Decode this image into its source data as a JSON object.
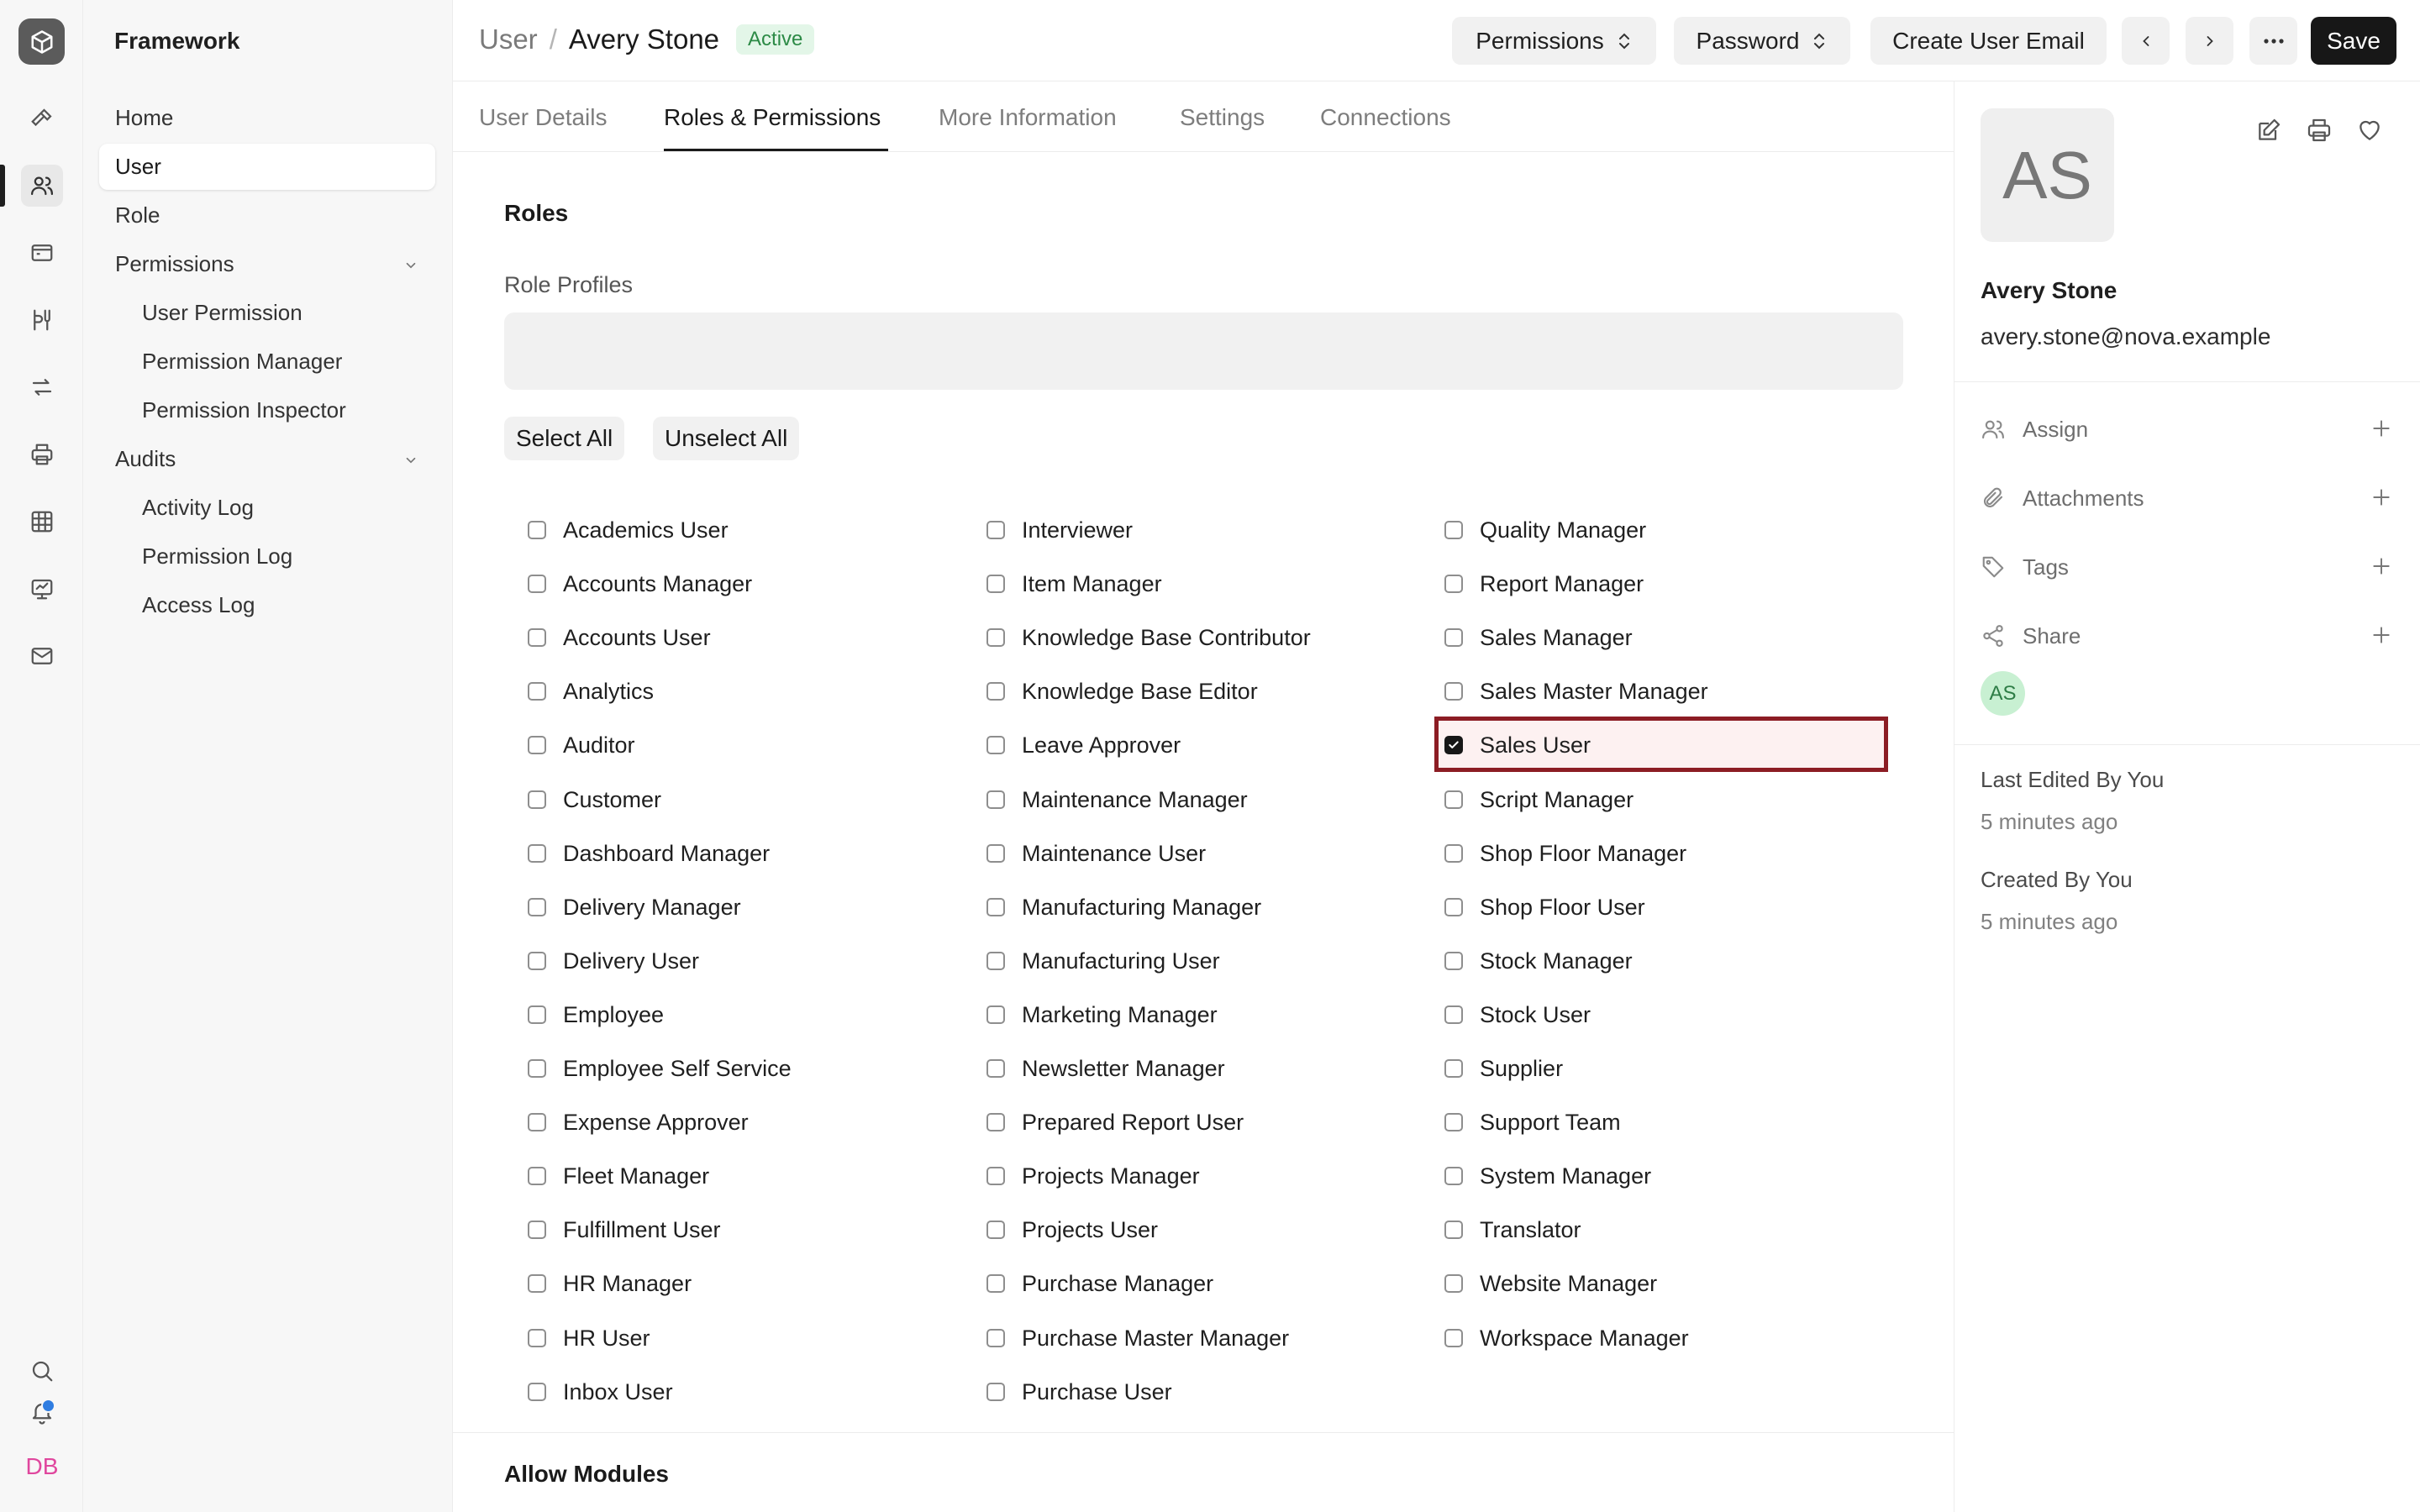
{
  "app": {
    "module_title": "Framework",
    "user_initials": "DB"
  },
  "sidebar": {
    "items": [
      {
        "label": "Home",
        "active": false,
        "sub": false
      },
      {
        "label": "User",
        "active": true,
        "sub": false
      },
      {
        "label": "Role",
        "active": false,
        "sub": false
      },
      {
        "label": "Permissions",
        "active": false,
        "sub": false,
        "expandable": true
      },
      {
        "label": "User Permission",
        "active": false,
        "sub": true
      },
      {
        "label": "Permission Manager",
        "active": false,
        "sub": true
      },
      {
        "label": "Permission Inspector",
        "active": false,
        "sub": true
      },
      {
        "label": "Audits",
        "active": false,
        "sub": false,
        "expandable": true
      },
      {
        "label": "Activity Log",
        "active": false,
        "sub": true
      },
      {
        "label": "Permission Log",
        "active": false,
        "sub": true
      },
      {
        "label": "Access Log",
        "active": false,
        "sub": true
      }
    ]
  },
  "header": {
    "breadcrumb_parent": "User",
    "breadcrumb_sep": "/",
    "breadcrumb_current": "Avery Stone",
    "status_badge": "Active",
    "permissions_label": "Permissions",
    "password_label": "Password",
    "create_email_label": "Create User Email",
    "save_label": "Save"
  },
  "tabs": [
    {
      "label": "User Details",
      "active": false
    },
    {
      "label": "Roles & Permissions",
      "active": true
    },
    {
      "label": "More Information",
      "active": false
    },
    {
      "label": "Settings",
      "active": false
    },
    {
      "label": "Connections",
      "active": false
    }
  ],
  "main": {
    "roles_title": "Roles",
    "role_profiles_label": "Role Profiles",
    "role_profiles_value": "",
    "select_all_label": "Select All",
    "unselect_all_label": "Unselect All",
    "allow_modules_title": "Allow Modules",
    "roles": [
      [
        "Academics User",
        "Accounts Manager",
        "Accounts User",
        "Analytics",
        "Auditor",
        "Customer",
        "Dashboard Manager",
        "Delivery Manager",
        "Delivery User",
        "Employee",
        "Employee Self Service",
        "Expense Approver",
        "Fleet Manager",
        "Fulfillment User",
        "HR Manager",
        "HR User",
        "Inbox User"
      ],
      [
        "Interviewer",
        "Item Manager",
        "Knowledge Base Contributor",
        "Knowledge Base Editor",
        "Leave Approver",
        "Maintenance Manager",
        "Maintenance User",
        "Manufacturing Manager",
        "Manufacturing User",
        "Marketing Manager",
        "Newsletter Manager",
        "Prepared Report User",
        "Projects Manager",
        "Projects User",
        "Purchase Manager",
        "Purchase Master Manager",
        "Purchase User"
      ],
      [
        "Quality Manager",
        "Report Manager",
        "Sales Manager",
        "Sales Master Manager",
        "Sales User",
        "Script Manager",
        "Shop Floor Manager",
        "Shop Floor User",
        "Stock Manager",
        "Stock User",
        "Supplier",
        "Support Team",
        "System Manager",
        "Translator",
        "Website Manager",
        "Workspace Manager"
      ]
    ],
    "checked_roles": [
      "Sales User"
    ]
  },
  "right_panel": {
    "avatar_initials": "AS",
    "name": "Avery Stone",
    "email": "avery.stone@nova.example",
    "assign_label": "Assign",
    "attachments_label": "Attachments",
    "tags_label": "Tags",
    "share_label": "Share",
    "shared_avatar_initials": "AS",
    "last_edited_label": "Last Edited By You",
    "last_edited_time": "5 minutes ago",
    "created_label": "Created By You",
    "created_time": "5 minutes ago"
  },
  "colors": {
    "accent": "#171717",
    "active_badge_bg": "#e3f6e8",
    "active_badge_text": "#2c8a46",
    "highlight_border": "#8c1d24",
    "user_initials": "#e0479e"
  }
}
